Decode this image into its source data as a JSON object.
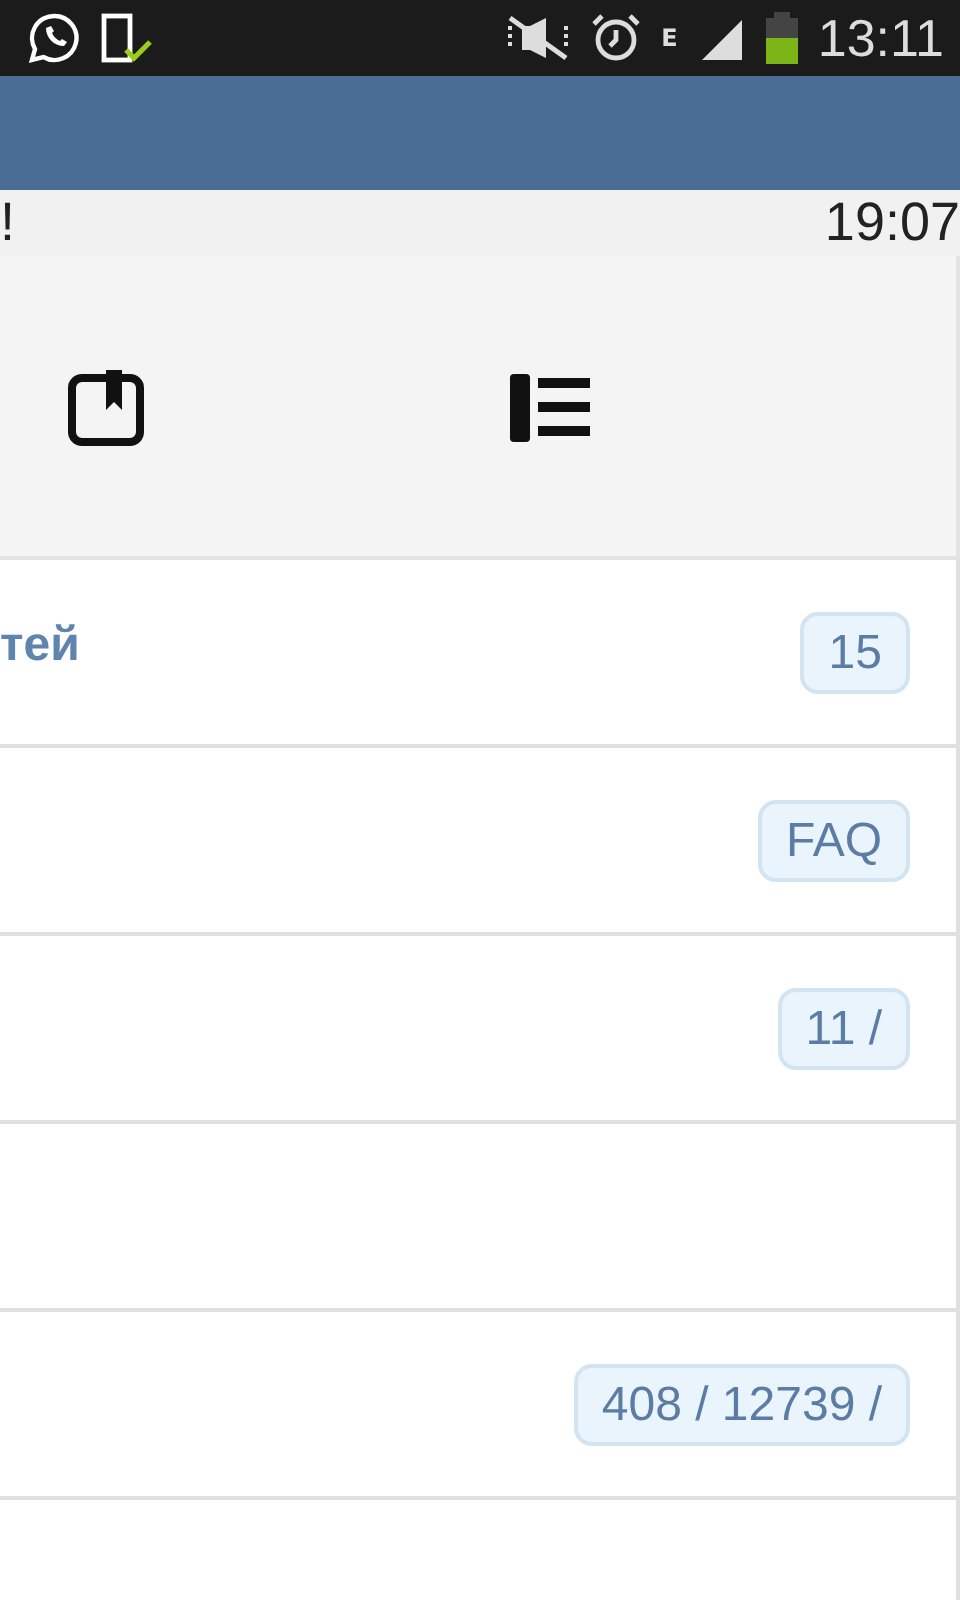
{
  "status_bar": {
    "time": "13:11",
    "network": "E"
  },
  "info_bar": {
    "left": "!",
    "time": "19:07"
  },
  "toolbar": [
    {
      "kind": "bookmark"
    },
    {
      "kind": "list"
    }
  ],
  "rows": [
    {
      "title": "тей",
      "badge": "15"
    },
    {
      "badge": "FAQ"
    },
    {
      "badge": "11 /"
    },
    {},
    {
      "badge": "408 / 12739 /"
    },
    {}
  ]
}
